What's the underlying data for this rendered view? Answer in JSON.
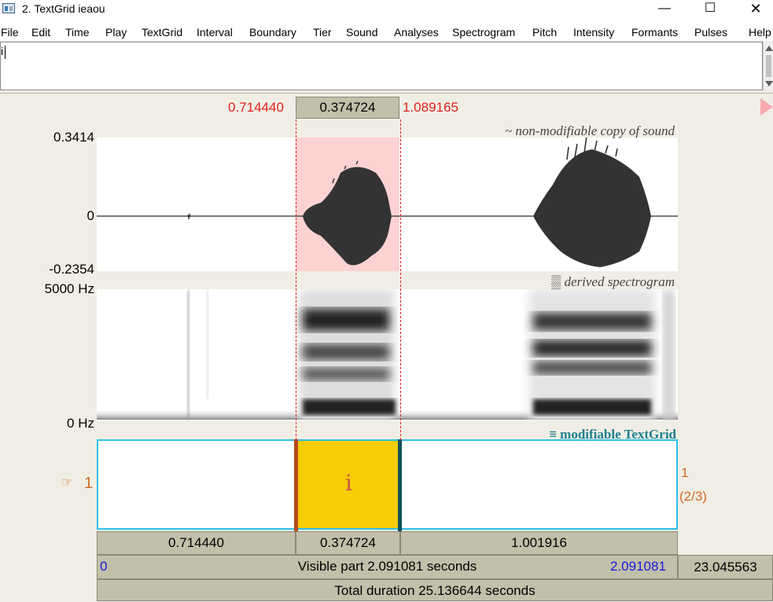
{
  "window": {
    "title": "2. TextGrid ieaou",
    "controls": {
      "minimize": "—",
      "maximize": "☐",
      "close": "✕"
    }
  },
  "menu": [
    "File",
    "Edit",
    "Time",
    "Play",
    "TextGrid",
    "Interval",
    "Boundary",
    "Tier",
    "Sound",
    "Analyses",
    "Spectrogram",
    "Pitch",
    "Intensity",
    "Formants",
    "Pulses",
    "Help"
  ],
  "text_field": {
    "value": "i"
  },
  "selection": {
    "start": "0.714440",
    "duration": "0.374724",
    "end": "1.089165"
  },
  "waveform": {
    "max": "0.3414",
    "zero": "0",
    "min": "-0.2354",
    "caption": "~ non-modifiable copy of sound"
  },
  "spectrogram": {
    "max": "5000 Hz",
    "min": "0 Hz",
    "caption": "▒ derived spectrogram"
  },
  "textgrid": {
    "caption": "≡ modifiable TextGrid",
    "tier_pointer": "☞",
    "tier_number": "1",
    "tier_right_count": "1",
    "tier_right_fraction": "(2/3)",
    "interval_label": "i"
  },
  "interval_bar": [
    "0.714440",
    "0.374724",
    "1.001916"
  ],
  "visible": {
    "start": "0",
    "label": "Visible part 2.091081 seconds",
    "end": "2.091081",
    "outside_right": "23.045563"
  },
  "total": {
    "label": "Total duration 25.136644 seconds"
  },
  "colors": {
    "selection_red": "#e02020",
    "selection_fill": "#ffd2d2",
    "interval_fill": "#f7cd07",
    "tier_border": "#2fc0e8",
    "panel_bar": "#c2bfaa",
    "tier_orange": "#cf6a23",
    "time_blue": "#1a1adf"
  }
}
